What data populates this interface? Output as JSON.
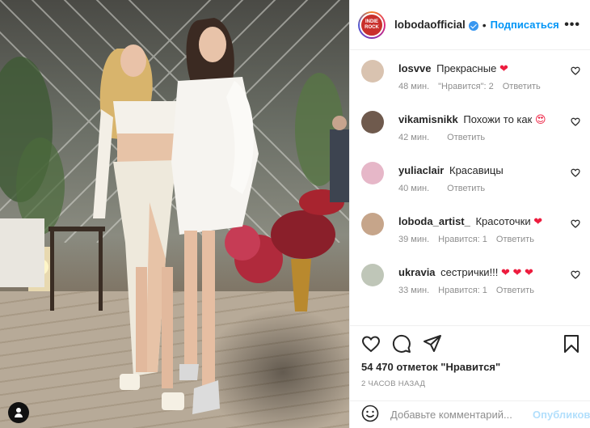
{
  "post": {
    "username": "lobodaofficial",
    "avatar_text": "INDIE ROCK",
    "separator": "•",
    "follow_label": "Подписаться",
    "more_label": "•••"
  },
  "comments": [
    {
      "user": "losvve",
      "text": "Прекрасные",
      "emoji": "❤",
      "time": "48 мин.",
      "likes": "\"Нравится\": 2",
      "reply": "Ответить",
      "avatar_color": "#d9c3b0"
    },
    {
      "user": "vikamisnikk",
      "text": "Похожи то как",
      "emoji": "😍",
      "time": "42 мин.",
      "likes": "",
      "reply": "Ответить",
      "avatar_color": "#6f5a4d"
    },
    {
      "user": "yuliaclair",
      "text": "Красавицы",
      "emoji": "",
      "time": "40 мин.",
      "likes": "",
      "reply": "Ответить",
      "avatar_color": "#e6b7c8"
    },
    {
      "user": "loboda_artist_",
      "text": "Красоточки",
      "emoji": "❤",
      "time": "39 мин.",
      "likes": "Нравится: 1",
      "reply": "Ответить",
      "avatar_color": "#c6a58a"
    },
    {
      "user": "ukravia",
      "text": "сестрички!!!",
      "emoji": "❤ ❤ ❤",
      "time": "33 мин.",
      "likes": "Нравится: 1",
      "reply": "Ответить",
      "avatar_color": "#bfc6b8"
    }
  ],
  "actions": {
    "likes_text": "54 470 отметок \"Нравится\"",
    "time_ago": "2 часов назад"
  },
  "comment_input": {
    "placeholder": "Добавьте комментарий...",
    "publish_label": "Опубликовать"
  },
  "colors": {
    "accent": "#0095f6",
    "heart": "#ed1c3e",
    "muted": "#8e8e8e"
  }
}
